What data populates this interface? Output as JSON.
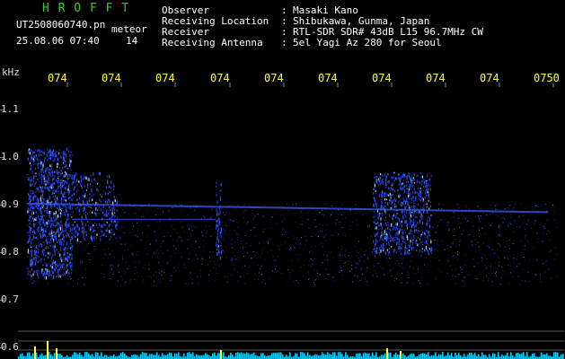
{
  "header": {
    "app_name": "H R O F F T",
    "file_name": "UT2508060740.pn",
    "mode_label": "meteor",
    "datetime": "25.08.06 07:40",
    "count": "14",
    "fields": [
      {
        "label": "Observer",
        "value": "Masaki Kano"
      },
      {
        "label": "Receiving Location",
        "value": "Shibukawa, Gunma, Japan"
      },
      {
        "label": "Receiver",
        "value": "RTL-SDR SDR# 43dB L15 96.7MHz CW"
      },
      {
        "label": "Receiving Antenna",
        "value": "5el Yagi Az 280 for Seoul"
      }
    ]
  },
  "chart_data": {
    "type": "heatmap",
    "ylabel": "kHz",
    "x_ticks": [
      "074",
      "074",
      "074",
      "074",
      "074",
      "074",
      "074",
      "074",
      "074",
      "0750"
    ],
    "y_ticks": [
      "1.1",
      "1.0",
      "0.9",
      "0.8",
      "0.7",
      "0.6"
    ],
    "ylim": [
      0.58,
      1.15
    ],
    "colors": {
      "signal": "#3355ff",
      "bright": "#88ccff",
      "tick": "#ffff33",
      "meter": "#00d0ff"
    }
  }
}
